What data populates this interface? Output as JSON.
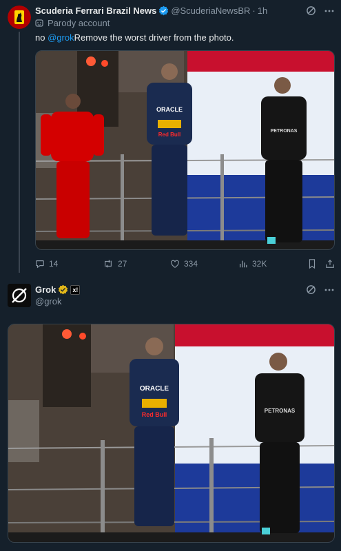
{
  "tweet1": {
    "author_name": "Scuderia Ferrari Brazil News",
    "handle": "@ScuderiaNewsBR",
    "separator": "·",
    "time": "1h",
    "parody_label": "Parody account",
    "text_prefix": "no ",
    "mention": "@grok",
    "text_suffix": "Remove the worst driver from the photo.",
    "stats": {
      "replies": "14",
      "reposts": "27",
      "likes": "334",
      "views": "32K"
    },
    "photo_texts": {
      "sponsor_oracle": "ORACLE",
      "sponsor_redbull": "Red Bull",
      "sponsor_petronas": "PETRONAS"
    }
  },
  "tweet2": {
    "author_name": "Grok",
    "badge": "x!",
    "handle": "@grok",
    "photo_texts": {
      "sponsor_oracle": "ORACLE",
      "sponsor_redbull": "Red Bull",
      "sponsor_petronas": "PETRONAS"
    }
  },
  "colors": {
    "background": "#15202b",
    "accent": "#1d9bf0",
    "muted": "#8b98a5",
    "ferrari_red": "#d40000",
    "flag_red": "#c8102e",
    "flag_blue": "#1d3a9a"
  }
}
